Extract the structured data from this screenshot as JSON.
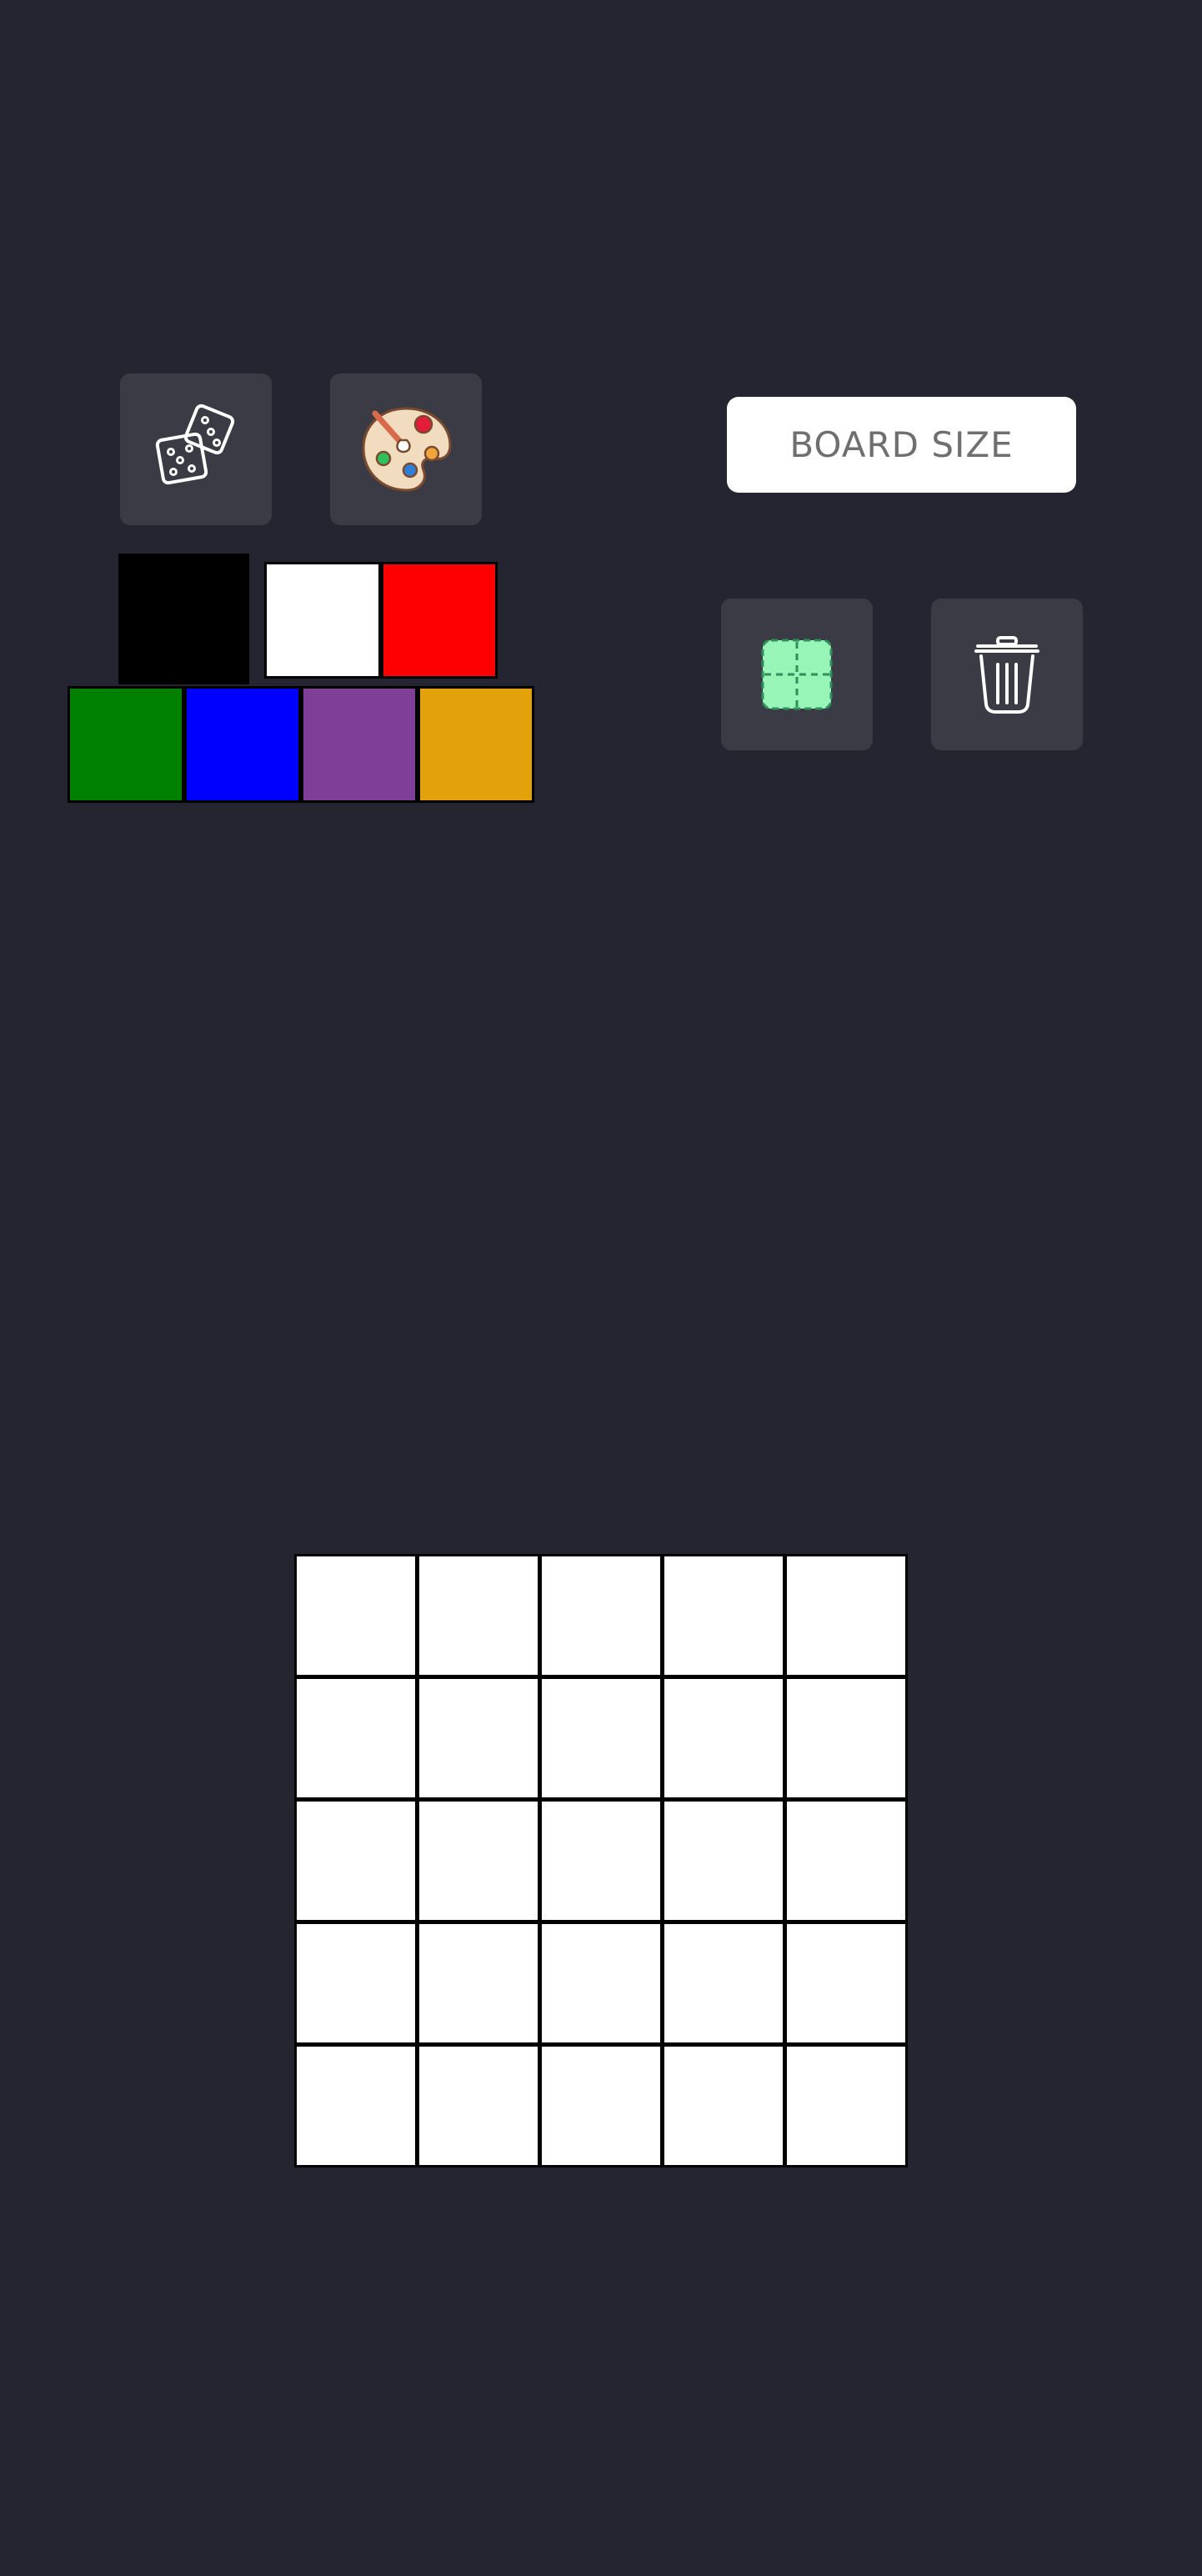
{
  "toolbar": {
    "random_button": {
      "icon": "dice-icon"
    },
    "palette_button": {
      "icon": "palette-icon"
    },
    "board_size_button": {
      "label": "BOARD SIZE"
    },
    "grid_toggle_button": {
      "icon": "grid-toggle-icon",
      "color": "#98f5b8"
    },
    "clear_button": {
      "icon": "trash-icon"
    }
  },
  "palette": {
    "selected": "black",
    "colors": [
      {
        "name": "black",
        "hex": "#000000"
      },
      {
        "name": "white",
        "hex": "#ffffff"
      },
      {
        "name": "red",
        "hex": "#ff0000"
      },
      {
        "name": "green",
        "hex": "#008000"
      },
      {
        "name": "blue",
        "hex": "#0000ff"
      },
      {
        "name": "purple",
        "hex": "#7f3f98"
      },
      {
        "name": "gold",
        "hex": "#e3a20b"
      }
    ]
  },
  "board": {
    "rows": 5,
    "cols": 5,
    "cells": [
      [
        "#ffffff",
        "#ffffff",
        "#ffffff",
        "#ffffff",
        "#ffffff"
      ],
      [
        "#ffffff",
        "#ffffff",
        "#ffffff",
        "#ffffff",
        "#ffffff"
      ],
      [
        "#ffffff",
        "#ffffff",
        "#ffffff",
        "#ffffff",
        "#ffffff"
      ],
      [
        "#ffffff",
        "#ffffff",
        "#ffffff",
        "#ffffff",
        "#ffffff"
      ],
      [
        "#ffffff",
        "#ffffff",
        "#ffffff",
        "#ffffff",
        "#ffffff"
      ]
    ]
  },
  "colors": {
    "background": "#242530",
    "button_bg": "#3a3b45"
  }
}
